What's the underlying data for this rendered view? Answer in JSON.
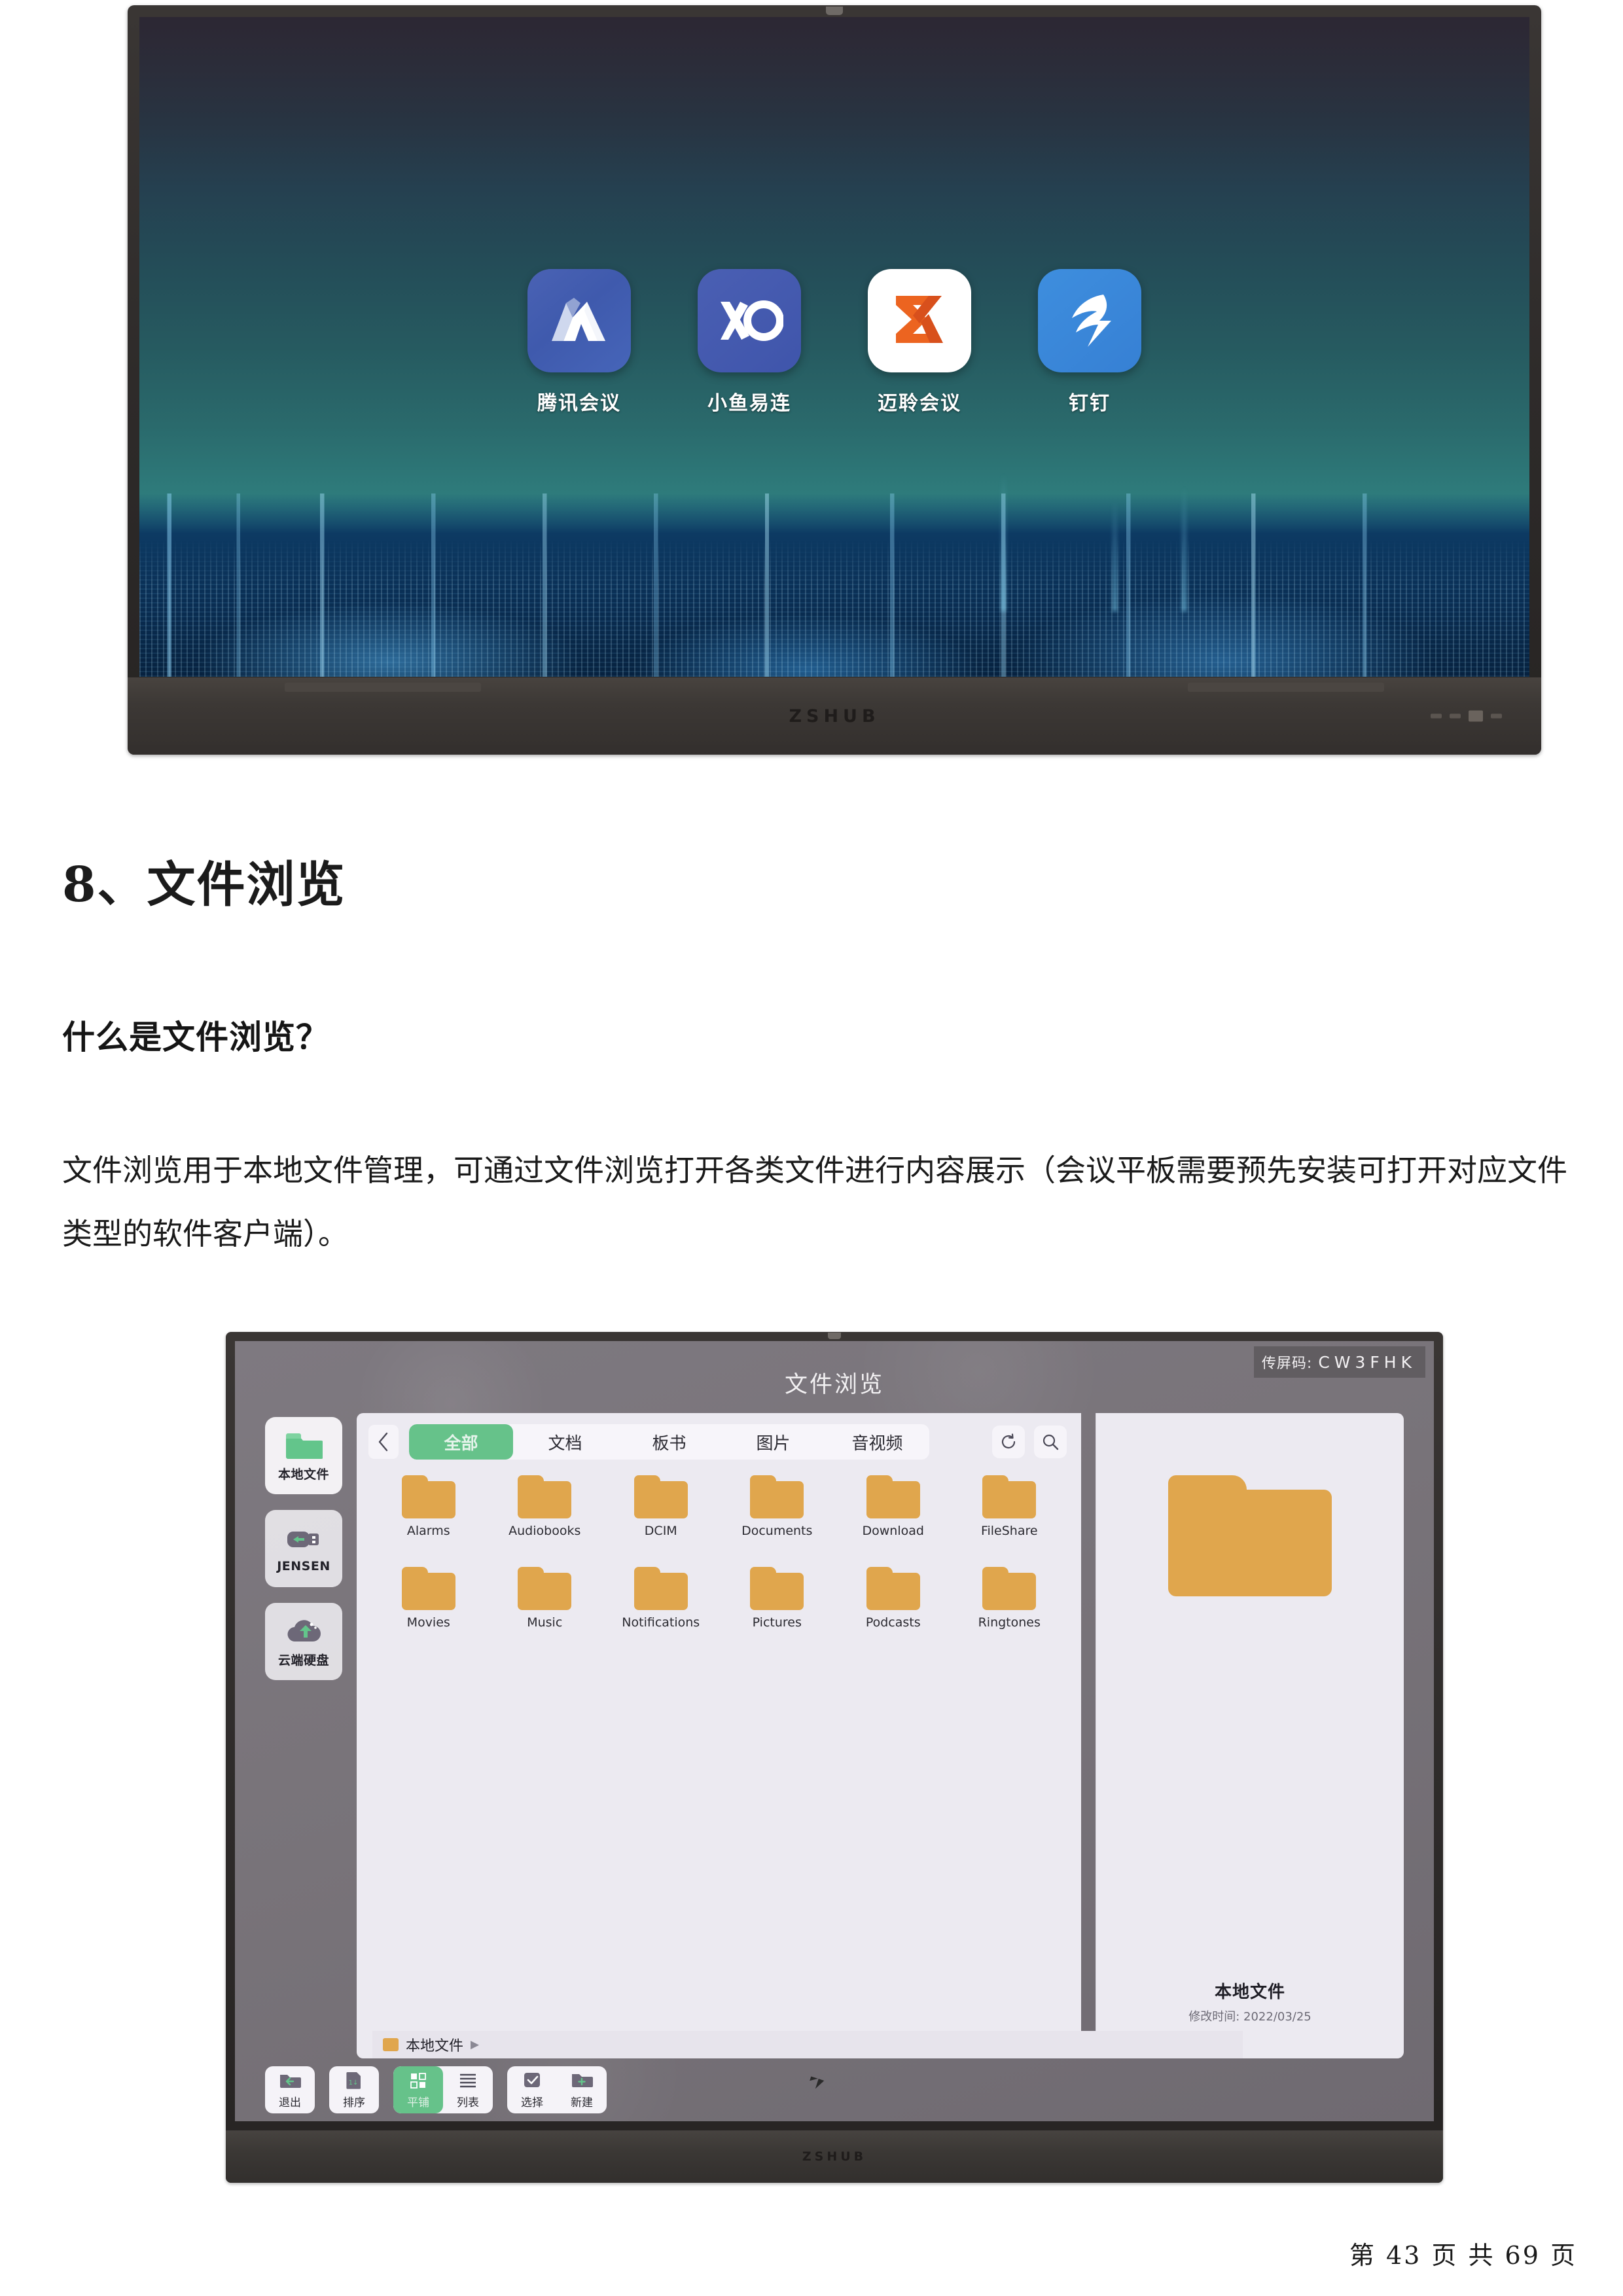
{
  "document": {
    "section_number": "8、",
    "section_title": "文件浏览",
    "subheading": "什么是文件浏览？",
    "paragraph": "文件浏览用于本地文件管理，可通过文件浏览打开各类文件进行内容展示（会议平板需要预先安装可打开对应文件类型的软件客户端）。",
    "footer": "第 43 页 共 69 页"
  },
  "display_top": {
    "brand": "ZSHUB",
    "apps": [
      {
        "label": "腾讯会议",
        "icon": "tencent-meeting-icon",
        "bg": "#4257ab"
      },
      {
        "label": "小鱼易连",
        "icon": "xylink-icon",
        "bg": "#4257ab"
      },
      {
        "label": "迈聆会议",
        "icon": "mailing-meeting-icon",
        "bg": "#ffffff"
      },
      {
        "label": "钉钉",
        "icon": "dingtalk-icon",
        "bg": "#3a85d8"
      }
    ]
  },
  "file_browser": {
    "brand": "ZSHUB",
    "title": "文件浏览",
    "cast_code_label": "传屏码:",
    "cast_code": "CW3FHK",
    "sidebar": [
      {
        "label": "本地文件",
        "icon": "folder-icon",
        "active": true
      },
      {
        "label": "JENSEN",
        "icon": "usb-drive-icon",
        "active": false
      },
      {
        "label": "云端硬盘",
        "icon": "cloud-drive-icon",
        "active": false
      }
    ],
    "tabs": [
      {
        "label": "全部",
        "active": true
      },
      {
        "label": "文档",
        "active": false
      },
      {
        "label": "板书",
        "active": false
      },
      {
        "label": "图片",
        "active": false
      },
      {
        "label": "音视频",
        "active": false
      }
    ],
    "tool_icons": [
      {
        "name": "refresh-icon"
      },
      {
        "name": "search-icon"
      }
    ],
    "folders": [
      "Alarms",
      "Audiobooks",
      "DCIM",
      "Documents",
      "Download",
      "FileShare",
      "Movies",
      "Music",
      "Notifications",
      "Pictures",
      "Podcasts",
      "Ringtones"
    ],
    "preview": {
      "name": "本地文件",
      "modified": "修改时间: 2022/03/25"
    },
    "breadcrumb": {
      "label": "本地文件",
      "arrow": "▶"
    },
    "bottom_tools": [
      {
        "label": "退出",
        "icon": "exit-folder-icon",
        "active": false
      },
      {
        "label": "排序",
        "icon": "sort-icon",
        "active": false
      },
      {
        "label": "平铺",
        "icon": "grid-view-icon",
        "active": true
      },
      {
        "label": "列表",
        "icon": "list-view-icon",
        "active": false
      },
      {
        "label": "选择",
        "icon": "select-check-icon",
        "active": false
      },
      {
        "label": "新建",
        "icon": "new-folder-icon",
        "active": false
      }
    ]
  },
  "colors": {
    "accent_green": "#66c28a",
    "folder_orange": "#e0a64d",
    "panel_bg": "#eceaf1"
  }
}
